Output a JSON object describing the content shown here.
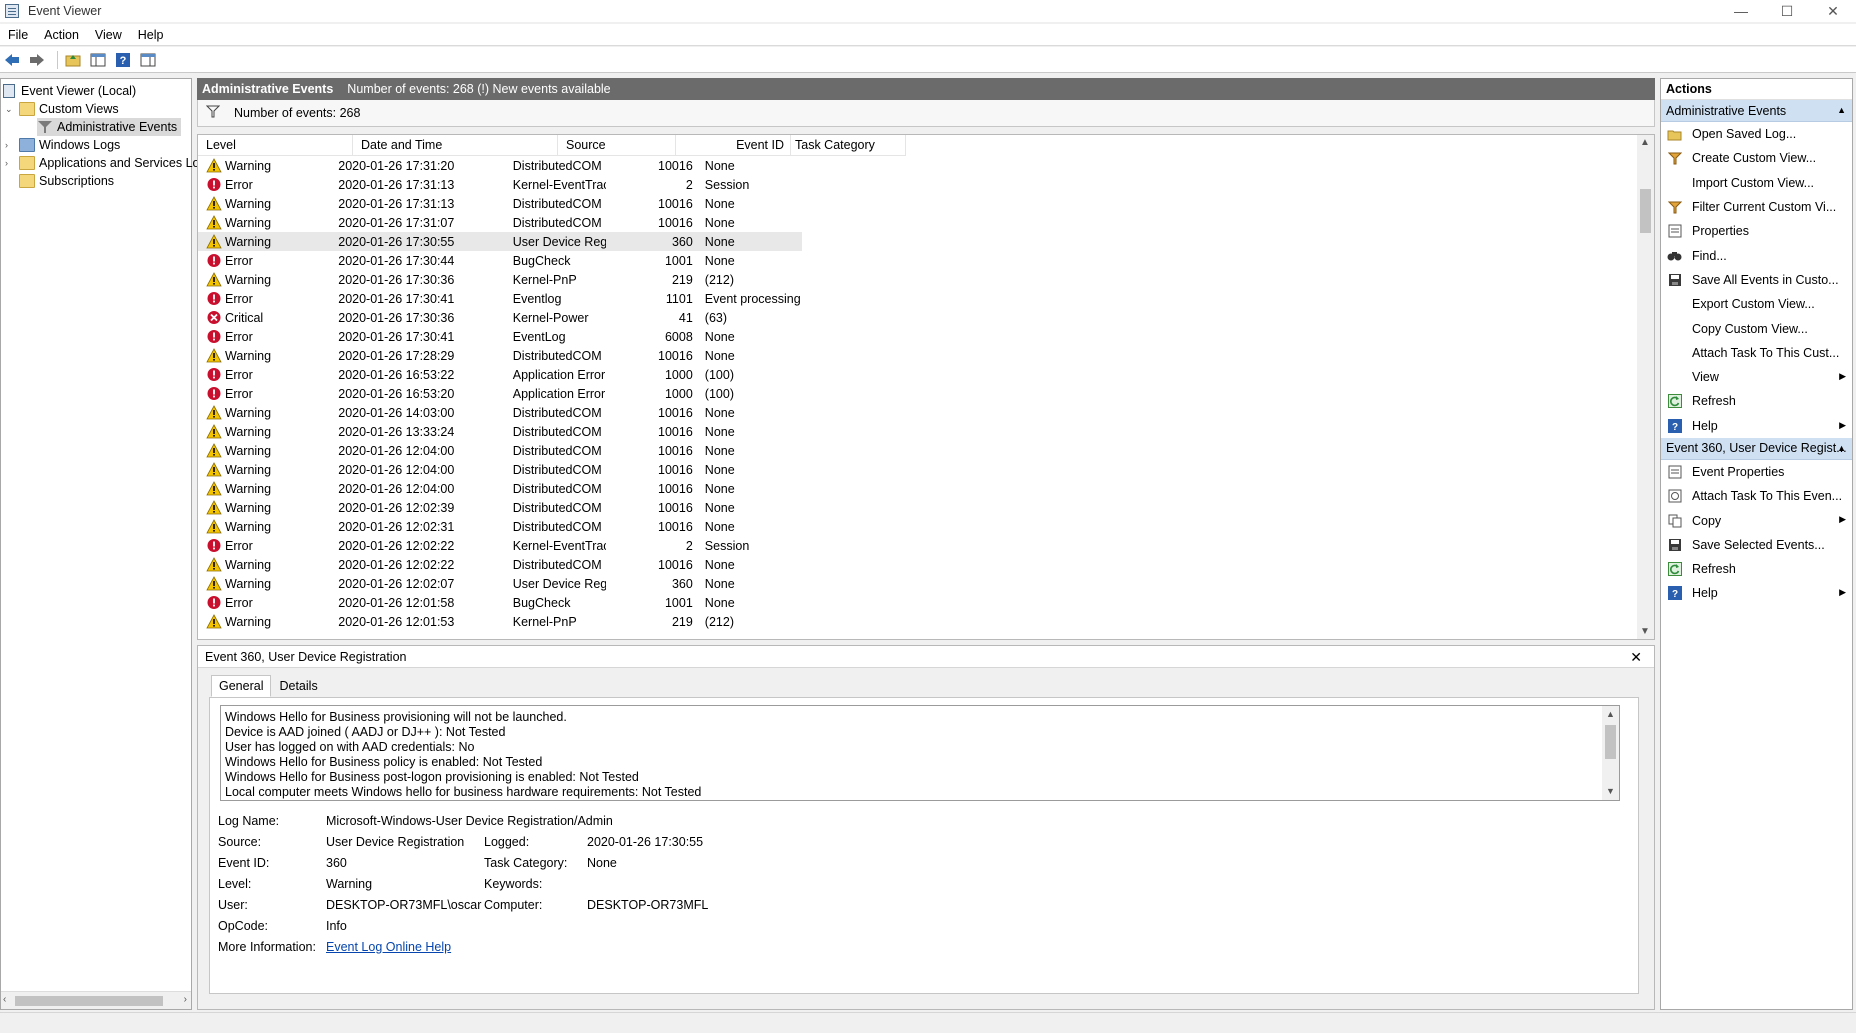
{
  "window": {
    "title": "Event Viewer",
    "controls": [
      "—",
      "☐",
      "✕"
    ]
  },
  "menu": [
    "File",
    "Action",
    "View",
    "Help"
  ],
  "tree": {
    "items": [
      {
        "label": "Event Viewer (Local)",
        "expander": ""
      },
      {
        "label": "Custom Views",
        "expander": "⌄"
      },
      {
        "label": "Administrative Events",
        "expander": ""
      },
      {
        "label": "Windows Logs",
        "expander": "›"
      },
      {
        "label": "Applications and Services Lo",
        "expander": "›"
      },
      {
        "label": "Subscriptions",
        "expander": ""
      }
    ]
  },
  "main": {
    "header_title": "Administrative Events",
    "header_info": "Number of events: 268 (!) New events available",
    "filter_text": "Number of events: 268",
    "columns": [
      "Level",
      "Date and Time",
      "Source",
      "Event ID",
      "Task Category"
    ],
    "rows": [
      {
        "level": "Warning",
        "date": "2020-01-26 17:31:20",
        "source": "DistributedCOM",
        "id": "10016",
        "cat": "None"
      },
      {
        "level": "Error",
        "date": "2020-01-26 17:31:13",
        "source": "Kernel-EventTraci...",
        "id": "2",
        "cat": "Session"
      },
      {
        "level": "Warning",
        "date": "2020-01-26 17:31:13",
        "source": "DistributedCOM",
        "id": "10016",
        "cat": "None"
      },
      {
        "level": "Warning",
        "date": "2020-01-26 17:31:07",
        "source": "DistributedCOM",
        "id": "10016",
        "cat": "None"
      },
      {
        "level": "Warning",
        "date": "2020-01-26 17:30:55",
        "source": "User Device Regis...",
        "id": "360",
        "cat": "None"
      },
      {
        "level": "Error",
        "date": "2020-01-26 17:30:44",
        "source": "BugCheck",
        "id": "1001",
        "cat": "None"
      },
      {
        "level": "Warning",
        "date": "2020-01-26 17:30:36",
        "source": "Kernel-PnP",
        "id": "219",
        "cat": "(212)"
      },
      {
        "level": "Error",
        "date": "2020-01-26 17:30:41",
        "source": "Eventlog",
        "id": "1101",
        "cat": "Event processing"
      },
      {
        "level": "Critical",
        "date": "2020-01-26 17:30:36",
        "source": "Kernel-Power",
        "id": "41",
        "cat": "(63)"
      },
      {
        "level": "Error",
        "date": "2020-01-26 17:30:41",
        "source": "EventLog",
        "id": "6008",
        "cat": "None"
      },
      {
        "level": "Warning",
        "date": "2020-01-26 17:28:29",
        "source": "DistributedCOM",
        "id": "10016",
        "cat": "None"
      },
      {
        "level": "Error",
        "date": "2020-01-26 16:53:22",
        "source": "Application Error",
        "id": "1000",
        "cat": "(100)"
      },
      {
        "level": "Error",
        "date": "2020-01-26 16:53:20",
        "source": "Application Error",
        "id": "1000",
        "cat": "(100)"
      },
      {
        "level": "Warning",
        "date": "2020-01-26 14:03:00",
        "source": "DistributedCOM",
        "id": "10016",
        "cat": "None"
      },
      {
        "level": "Warning",
        "date": "2020-01-26 13:33:24",
        "source": "DistributedCOM",
        "id": "10016",
        "cat": "None"
      },
      {
        "level": "Warning",
        "date": "2020-01-26 12:04:00",
        "source": "DistributedCOM",
        "id": "10016",
        "cat": "None"
      },
      {
        "level": "Warning",
        "date": "2020-01-26 12:04:00",
        "source": "DistributedCOM",
        "id": "10016",
        "cat": "None"
      },
      {
        "level": "Warning",
        "date": "2020-01-26 12:04:00",
        "source": "DistributedCOM",
        "id": "10016",
        "cat": "None"
      },
      {
        "level": "Warning",
        "date": "2020-01-26 12:02:39",
        "source": "DistributedCOM",
        "id": "10016",
        "cat": "None"
      },
      {
        "level": "Warning",
        "date": "2020-01-26 12:02:31",
        "source": "DistributedCOM",
        "id": "10016",
        "cat": "None"
      },
      {
        "level": "Error",
        "date": "2020-01-26 12:02:22",
        "source": "Kernel-EventTraci...",
        "id": "2",
        "cat": "Session"
      },
      {
        "level": "Warning",
        "date": "2020-01-26 12:02:22",
        "source": "DistributedCOM",
        "id": "10016",
        "cat": "None"
      },
      {
        "level": "Warning",
        "date": "2020-01-26 12:02:07",
        "source": "User Device Regis...",
        "id": "360",
        "cat": "None"
      },
      {
        "level": "Error",
        "date": "2020-01-26 12:01:58",
        "source": "BugCheck",
        "id": "1001",
        "cat": "None"
      },
      {
        "level": "Warning",
        "date": "2020-01-26 12:01:53",
        "source": "Kernel-PnP",
        "id": "219",
        "cat": "(212)"
      }
    ],
    "selected_row": 4
  },
  "detail": {
    "title": "Event 360, User Device Registration",
    "close": "✕",
    "tabs": [
      "General",
      "Details"
    ],
    "description": [
      "Windows Hello for Business provisioning will not be launched.",
      "Device is AAD joined ( AADJ or DJ++ ): Not Tested",
      "User has logged on with AAD credentials: No",
      "Windows Hello for Business policy is enabled: Not Tested",
      "Windows Hello for Business post-logon provisioning is enabled: Not Tested",
      "Local computer meets Windows hello for business hardware requirements: Not Tested"
    ],
    "labels": {
      "log_name": "Log Name:",
      "source": "Source:",
      "event_id": "Event ID:",
      "level": "Level:",
      "user": "User:",
      "opcode": "OpCode:",
      "more_info": "More Information:",
      "logged": "Logged:",
      "task_category": "Task Category:",
      "keywords": "Keywords:",
      "computer": "Computer:"
    },
    "values": {
      "log_name": "Microsoft-Windows-User Device Registration/Admin",
      "source": "User Device Registration",
      "event_id": "360",
      "level": "Warning",
      "user": "DESKTOP-OR73MFL\\oscar",
      "opcode": "Info",
      "more_info_link": "Event Log Online Help",
      "logged": "2020-01-26 17:30:55",
      "task_category": "None",
      "keywords": "",
      "computer": "DESKTOP-OR73MFL"
    }
  },
  "actions": {
    "title": "Actions",
    "section1": "Administrative Events",
    "items1": [
      {
        "label": "Open Saved Log...",
        "icon": "folder-open-icon"
      },
      {
        "label": "Create Custom View...",
        "icon": "filter-icon"
      },
      {
        "label": "Import Custom View...",
        "icon": ""
      },
      {
        "label": "Filter Current Custom Vi...",
        "icon": "filter-icon"
      },
      {
        "label": "Properties",
        "icon": "properties-icon"
      },
      {
        "label": "Find...",
        "icon": "binoculars-icon"
      },
      {
        "label": "Save All Events in Custo...",
        "icon": "save-icon"
      },
      {
        "label": "Export Custom View...",
        "icon": ""
      },
      {
        "label": "Copy Custom View...",
        "icon": ""
      },
      {
        "label": "Attach Task To This Cust...",
        "icon": ""
      },
      {
        "label": "View",
        "icon": "",
        "submenu": true
      },
      {
        "label": "Refresh",
        "icon": "refresh-icon"
      },
      {
        "label": "Help",
        "icon": "help-icon",
        "submenu": true
      }
    ],
    "section2": "Event 360, User Device Regist...",
    "items2": [
      {
        "label": "Event Properties",
        "icon": "properties-icon"
      },
      {
        "label": "Attach Task To This Even...",
        "icon": "task-icon"
      },
      {
        "label": "Copy",
        "icon": "copy-icon",
        "submenu": true
      },
      {
        "label": "Save Selected Events...",
        "icon": "save-icon"
      },
      {
        "label": "Refresh",
        "icon": "refresh-icon"
      },
      {
        "label": "Help",
        "icon": "help-icon",
        "submenu": true
      }
    ]
  },
  "colors": {
    "warning": "#f5c400",
    "error": "#c8102e",
    "section": "#cfe0f3",
    "header": "#6b6b6b"
  }
}
